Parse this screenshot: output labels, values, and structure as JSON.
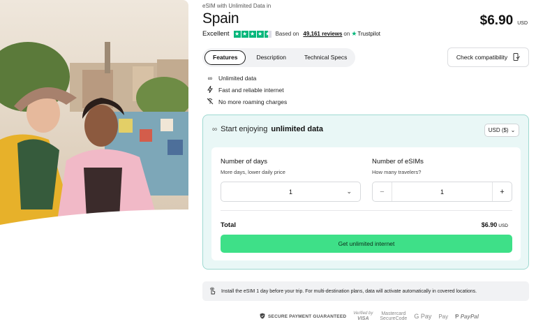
{
  "header": {
    "eyebrow": "eSIM with Unlimited Data in",
    "title": "Spain",
    "price": "$6.90",
    "price_currency": "USD"
  },
  "rating": {
    "label": "Excellent",
    "stars": 4.5,
    "based_on": "Based on",
    "reviews": "49,161 reviews",
    "on": "on",
    "provider": "Trustpilot"
  },
  "tabs": [
    {
      "label": "Features",
      "active": true
    },
    {
      "label": "Description",
      "active": false
    },
    {
      "label": "Technical Specs",
      "active": false
    }
  ],
  "compat_button": "Check compatibility",
  "features": [
    {
      "icon": "infinity-icon",
      "label": "Unlimited data"
    },
    {
      "icon": "lightning-icon",
      "label": "Fast and reliable internet"
    },
    {
      "icon": "no-roaming-icon",
      "label": "No more roaming charges"
    }
  ],
  "card": {
    "heading_prefix": "Start enjoying",
    "heading_bold": "unlimited data",
    "currency_select": "USD ($)",
    "days_label": "Number of days",
    "days_sub": "More days, lower daily price",
    "days_value": "1",
    "esims_label": "Number of eSIMs",
    "esims_sub": "How many travelers?",
    "esims_value": "1",
    "minus": "−",
    "plus": "+",
    "total_label": "Total",
    "total_value": "$6.90",
    "total_currency": "USD",
    "cta": "Get unlimited internet"
  },
  "notice": "Install the eSIM 1 day before your trip. For multi-destination plans, data will activate automatically in covered locations.",
  "payments": {
    "secure": "SECURE PAYMENT GUARANTEED",
    "visa_top": "Verified by",
    "visa_bottom": "VISA",
    "mc_top": "Mastercard",
    "mc_bottom": "SecureCode",
    "gpay": "G Pay",
    "apay": " Pay",
    "paypal": "PayPal"
  },
  "colors": {
    "accent_green": "#3ee088",
    "card_bg": "#e9f7f6",
    "card_border": "#9fd9d1",
    "trustpilot": "#00b67a"
  }
}
